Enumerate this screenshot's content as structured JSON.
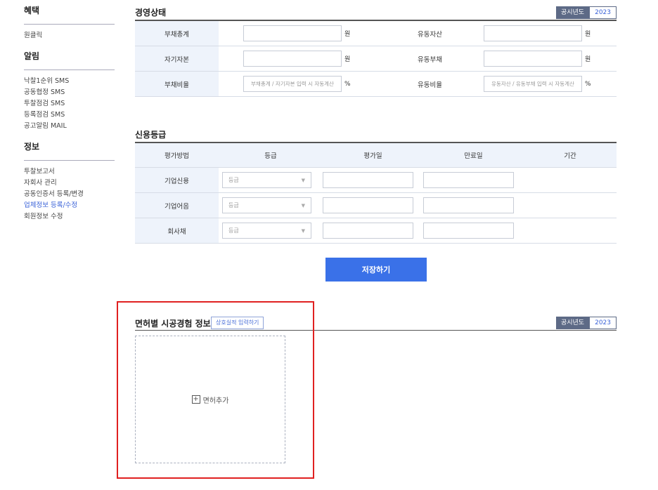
{
  "sidebar": {
    "sections": [
      {
        "title": "혜택",
        "items": [
          {
            "label": "원클릭"
          }
        ]
      },
      {
        "title": "알림",
        "items": [
          {
            "label": "낙찰1순위 SMS"
          },
          {
            "label": "공동협정 SMS"
          },
          {
            "label": "투찰점검 SMS"
          },
          {
            "label": "등록점검 SMS"
          },
          {
            "label": "공고알림 MAIL"
          }
        ]
      },
      {
        "title": "정보",
        "items": [
          {
            "label": "투찰보고서"
          },
          {
            "label": "자회사 관리"
          },
          {
            "label": "공동인증서 등록/변경"
          },
          {
            "label": "업체정보 등록/수정"
          },
          {
            "label": "회원정보 수정"
          }
        ]
      }
    ]
  },
  "management": {
    "title": "경영상태",
    "year_label": "공시년도",
    "year_value": "2023",
    "rows": [
      {
        "left_label": "부채총계",
        "left_unit": "원",
        "right_label": "유동자산",
        "right_unit": "원"
      },
      {
        "left_label": "자기자본",
        "left_unit": "원",
        "right_label": "유동부채",
        "right_unit": "원"
      },
      {
        "left_label": "부채비율",
        "left_placeholder": "부채총계 / 자기자본 입력 시 자동계산",
        "left_unit": "%",
        "right_label": "유동비율",
        "right_placeholder": "유동자산 / 유동부채 입력 시 자동계산",
        "right_unit": "%"
      }
    ]
  },
  "credit": {
    "title": "신용등급",
    "headers": {
      "method": "평가방법",
      "grade": "등급",
      "eval_date": "평가일",
      "expire_date": "만료일",
      "period": "기간"
    },
    "rows": [
      {
        "method": "기업신용",
        "grade_placeholder": "등급"
      },
      {
        "method": "기업어음",
        "grade_placeholder": "등급"
      },
      {
        "method": "회사채",
        "grade_placeholder": "등급"
      }
    ]
  },
  "save_label": "저장하기",
  "license": {
    "title": "면허별 시공경험 정보",
    "input_link": "상호실적 입력하기",
    "year_label": "공시년도",
    "year_value": "2023",
    "add_label": "면허추가"
  }
}
